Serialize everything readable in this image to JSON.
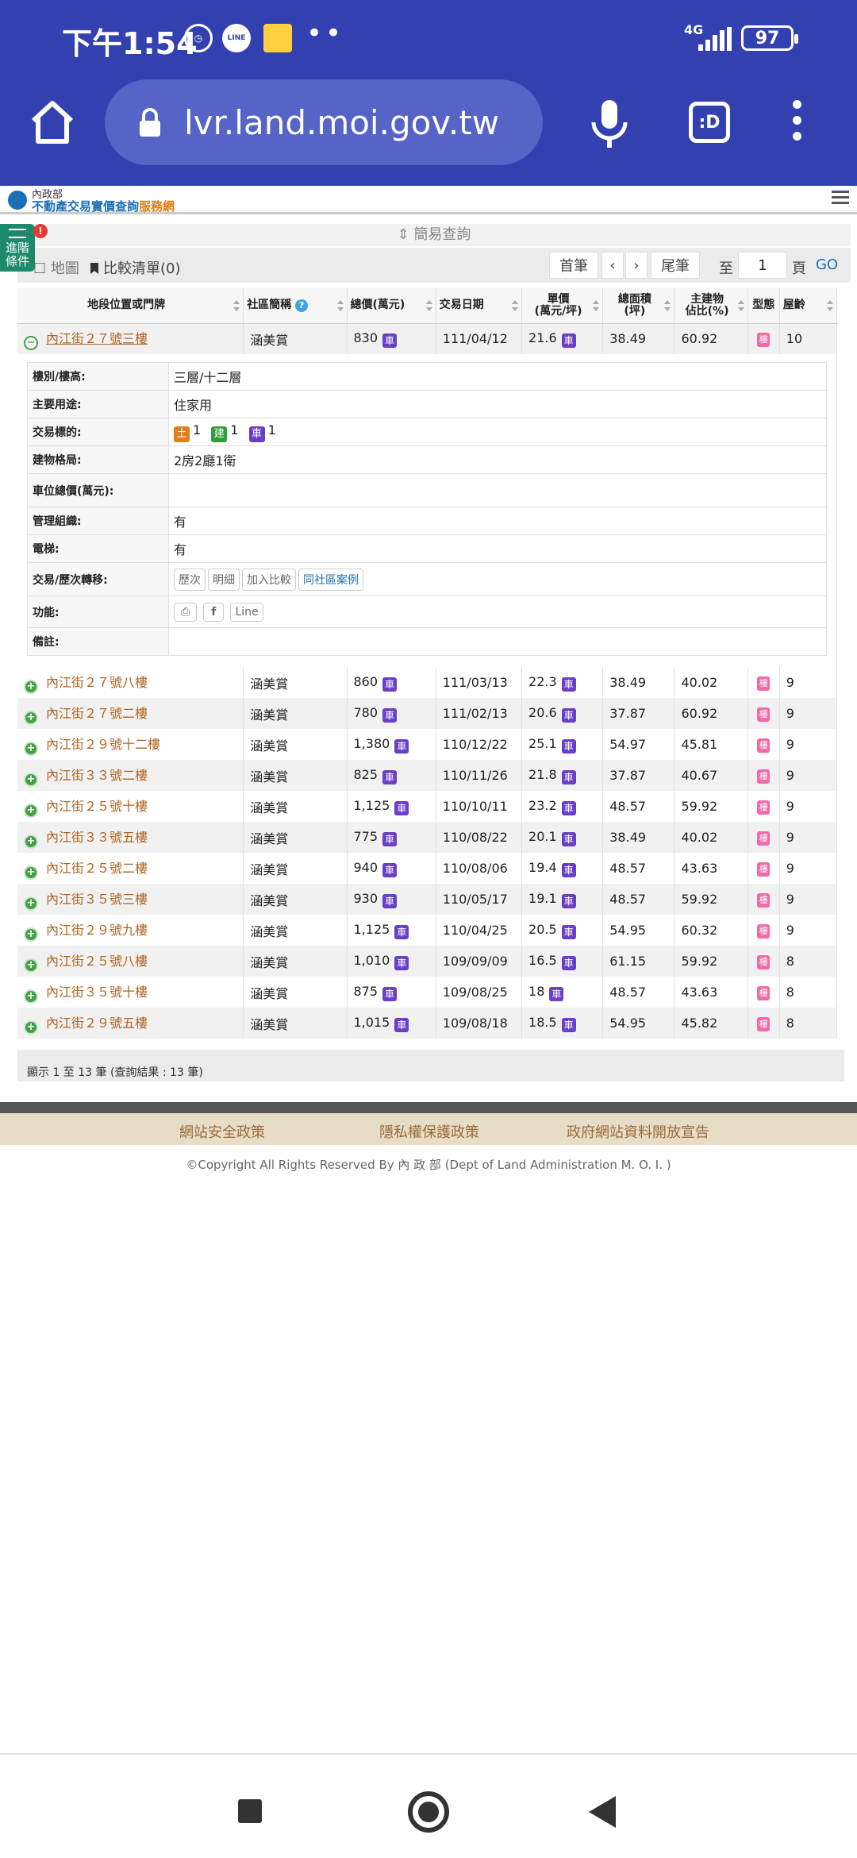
{
  "status_bar": {
    "time": "下午1:54",
    "network": "4G",
    "battery": "97"
  },
  "browser": {
    "url": "lvr.land.moi.gov.tw"
  },
  "site": {
    "title_small": "內政部",
    "title_main": "不動產交易實價查詢",
    "title_accent": "服務網"
  },
  "search": {
    "advanced_label": "進階條件",
    "alert": "!",
    "simple_query": "簡易查詢",
    "map_label": "地圖",
    "compare_label": "比較清單(0)",
    "first": "首筆",
    "prev": "‹",
    "next": "›",
    "last": "尾筆",
    "to_label": "至",
    "page_value": "1",
    "page_label": "頁",
    "go": "GO"
  },
  "table": {
    "headers": [
      "地段位置或門牌",
      "社區簡稱",
      "總價(萬元)",
      "交易日期",
      "單價\n(萬元/坪)",
      "總面積\n(坪)",
      "主建物\n佔比(%)",
      "型態",
      "屋齡"
    ],
    "expanded_row": {
      "address": "內江街２７號三樓",
      "community": "涵美賞",
      "price": "830",
      "date": "111/04/12",
      "unit": "21.6",
      "area": "38.49",
      "ratio": "60.92",
      "age": "10"
    },
    "detail": {
      "floor_label": "樓別/樓高:",
      "floor": "三層/十二層",
      "use_label": "主要用途:",
      "use": "住家用",
      "target_label": "交易標的:",
      "target_land": "1",
      "target_building": "1",
      "target_car": "1",
      "layout_label": "建物格局:",
      "layout": "2房2廳1衛",
      "parking_label": "車位總價(萬元):",
      "parking": "",
      "mgmt_label": "管理組織:",
      "mgmt": "有",
      "elevator_label": "電梯:",
      "elevator": "有",
      "history_label": "交易/歷次轉移:",
      "btn_history": "歷次",
      "btn_detail": "明細",
      "btn_compare": "加入比較",
      "btn_same": "同社區案例",
      "func_label": "功能:",
      "btn_line": "Line",
      "note_label": "備註:",
      "note": ""
    },
    "rows": [
      {
        "address": "內江街２７號八樓",
        "community": "涵美賞",
        "price": "860",
        "date": "111/03/13",
        "unit": "22.3",
        "area": "38.49",
        "ratio": "40.02",
        "age": "9"
      },
      {
        "address": "內江街２７號二樓",
        "community": "涵美賞",
        "price": "780",
        "date": "111/02/13",
        "unit": "20.6",
        "area": "37.87",
        "ratio": "60.92",
        "age": "9"
      },
      {
        "address": "內江街２９號十二樓",
        "community": "涵美賞",
        "price": "1,380",
        "date": "110/12/22",
        "unit": "25.1",
        "area": "54.97",
        "ratio": "45.81",
        "age": "9"
      },
      {
        "address": "內江街３３號二樓",
        "community": "涵美賞",
        "price": "825",
        "date": "110/11/26",
        "unit": "21.8",
        "area": "37.87",
        "ratio": "40.67",
        "age": "9"
      },
      {
        "address": "內江街２５號十樓",
        "community": "涵美賞",
        "price": "1,125",
        "date": "110/10/11",
        "unit": "23.2",
        "area": "48.57",
        "ratio": "59.92",
        "age": "9"
      },
      {
        "address": "內江街３３號五樓",
        "community": "涵美賞",
        "price": "775",
        "date": "110/08/22",
        "unit": "20.1",
        "area": "38.49",
        "ratio": "40.02",
        "age": "9"
      },
      {
        "address": "內江街２５號二樓",
        "community": "涵美賞",
        "price": "940",
        "date": "110/08/06",
        "unit": "19.4",
        "area": "48.57",
        "ratio": "43.63",
        "age": "9"
      },
      {
        "address": "內江街３５號三樓",
        "community": "涵美賞",
        "price": "930",
        "date": "110/05/17",
        "unit": "19.1",
        "area": "48.57",
        "ratio": "59.92",
        "age": "9"
      },
      {
        "address": "內江街２９號九樓",
        "community": "涵美賞",
        "price": "1,125",
        "date": "110/04/25",
        "unit": "20.5",
        "area": "54.95",
        "ratio": "60.32",
        "age": "9"
      },
      {
        "address": "內江街２５號八樓",
        "community": "涵美賞",
        "price": "1,010",
        "date": "109/09/09",
        "unit": "16.5",
        "area": "61.15",
        "ratio": "59.92",
        "age": "8"
      },
      {
        "address": "內江街３５號十樓",
        "community": "涵美賞",
        "price": "875",
        "date": "109/08/25",
        "unit": "18",
        "area": "48.57",
        "ratio": "43.63",
        "age": "8"
      },
      {
        "address": "內江街２９號五樓",
        "community": "涵美賞",
        "price": "1,015",
        "date": "109/08/18",
        "unit": "18.5",
        "area": "54.95",
        "ratio": "45.82",
        "age": "8"
      }
    ],
    "car_badge": "車",
    "type_badge": "樓",
    "land_badge": "土",
    "building_badge": "建",
    "count_text": "顯示 1 至 13 筆 (查詢結果 : 13 筆)"
  },
  "footer": {
    "link1": "網站安全政策",
    "link2": "隱私權保護政策",
    "link3": "政府網站資料開放宣告",
    "copyright": "©Copyright All Rights Reserved By 內 政 部 (Dept of Land Administration M. O. I. )"
  },
  "colors": {
    "browser": "#3340b0",
    "brand": "#1b6fb5",
    "accent": "#e07b12",
    "address": "#b06420",
    "car": "#6a3fc6",
    "type": "#f06aa8"
  }
}
